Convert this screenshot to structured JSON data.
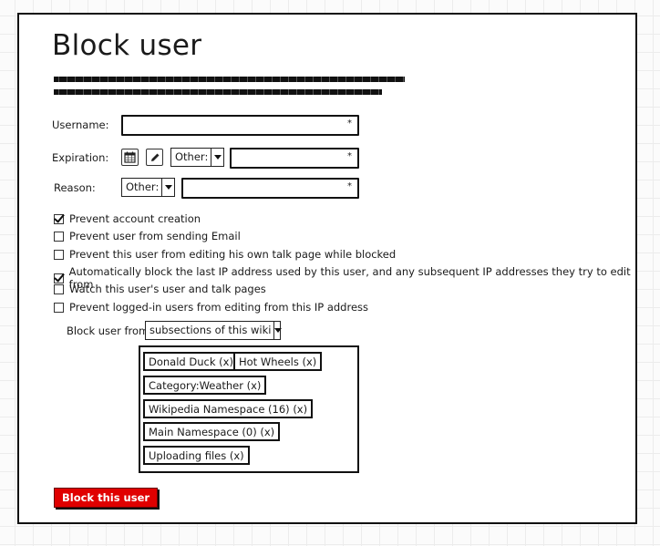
{
  "page": {
    "title": "Block user"
  },
  "description": {
    "lines": [
      "(greeked placeholder text line 1)",
      "(greeked placeholder text line 2)"
    ]
  },
  "form": {
    "username": {
      "label": "Username:",
      "value": "",
      "required_marker": "*"
    },
    "expiration": {
      "label": "Expiration:",
      "calendar_icon": "calendar-icon",
      "edit_icon": "pencil-icon",
      "select_value": "Other:",
      "value": "",
      "required_marker": "*"
    },
    "reason": {
      "label": "Reason:",
      "select_value": "Other:",
      "value": "",
      "required_marker": "*"
    }
  },
  "options": [
    {
      "label": "Prevent account creation",
      "checked": true
    },
    {
      "label": "Prevent user from sending Email",
      "checked": false
    },
    {
      "label": "Prevent this user from editing his own talk page while blocked",
      "checked": false
    },
    {
      "label": "Automatically block the last IP address used by this user, and any subsequent IP addresses they try to edit from",
      "checked": true
    },
    {
      "label": "Watch this user's user and talk pages",
      "checked": false
    },
    {
      "label": "Prevent logged-in users from editing from this IP address",
      "checked": false
    }
  ],
  "block_from": {
    "label": "Block user from:",
    "select_value": "subsections of this wiki",
    "items": [
      "Donald Duck (x)",
      "Hot Wheels (x)",
      "Category:Weather (x)",
      "Wikipedia Namespace (16) (x)",
      "Main Namespace (0) (x)",
      "Uploading files (x)"
    ]
  },
  "submit": {
    "label": "Block this user",
    "color": "#e00000"
  }
}
